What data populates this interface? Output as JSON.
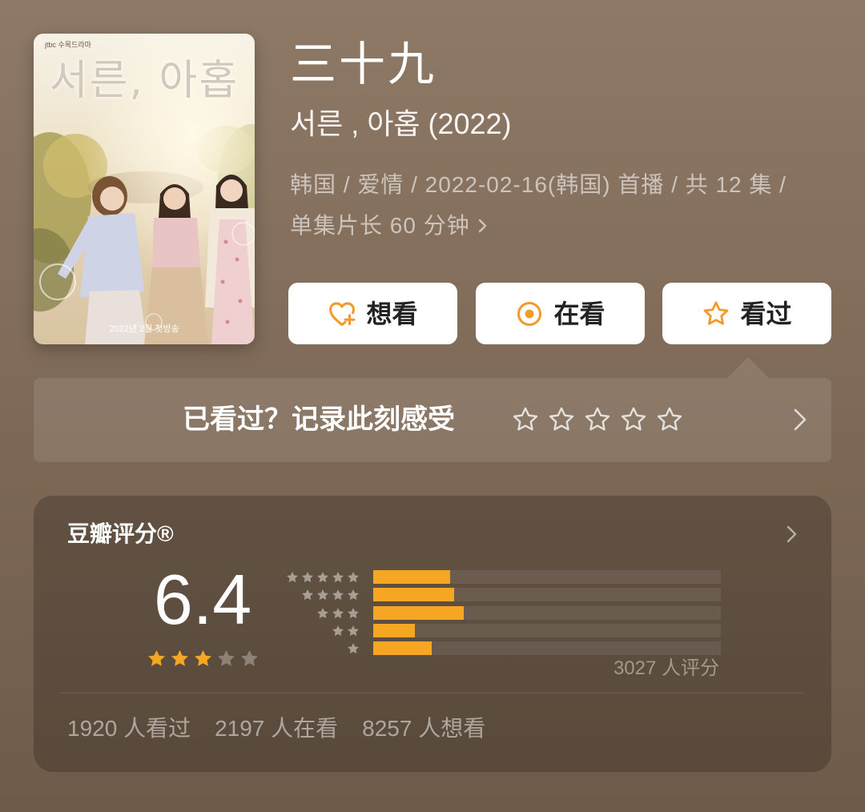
{
  "poster": {
    "network": "jtbc 수목드라마",
    "title": "서른, 아홉",
    "caption": "2022년 2월 첫방송"
  },
  "header": {
    "title": "三十九",
    "subtitle": "서른 , 아홉 (2022)",
    "meta_line1": "韩国 / 爱情 / 2022-02-16(韩国) 首播 / 共 12 集 /",
    "meta_line2": "单集片长 60 分钟",
    "meta_icon": "chevron-right-icon"
  },
  "actions": [
    {
      "label": "想看",
      "icon": "heart-plus-icon"
    },
    {
      "label": "在看",
      "icon": "target-icon"
    },
    {
      "label": "看过",
      "icon": "star-outline-icon"
    }
  ],
  "rate_prompt": {
    "text": "已看过？记录此刻感受",
    "star_count": 5,
    "icon": "chevron-right-icon"
  },
  "rating": {
    "label": "豆瓣评分®",
    "score": "6.4",
    "stars_filled": 3,
    "stars_total": 5,
    "count_text": "3027 人评分",
    "distribution": [
      {
        "stars": 5,
        "percent": 22.1
      },
      {
        "stars": 4,
        "percent": 23.2
      },
      {
        "stars": 3,
        "percent": 26.0
      },
      {
        "stars": 2,
        "percent": 11.9
      },
      {
        "stars": 1,
        "percent": 16.8
      }
    ]
  },
  "stats": [
    "1920 人看过",
    "2197 人在看",
    "8257 人想看"
  ],
  "colors": {
    "accent": "#f5a623",
    "icon_orange": "#f29b2c",
    "background_top": "#8e7966",
    "background_bottom": "#6e5b49",
    "button_background": "#ffffff",
    "button_text": "#222222",
    "empty_star": "rgba(255,255,255,0.3)",
    "dist_star": "rgba(255,255,255,0.45)"
  }
}
